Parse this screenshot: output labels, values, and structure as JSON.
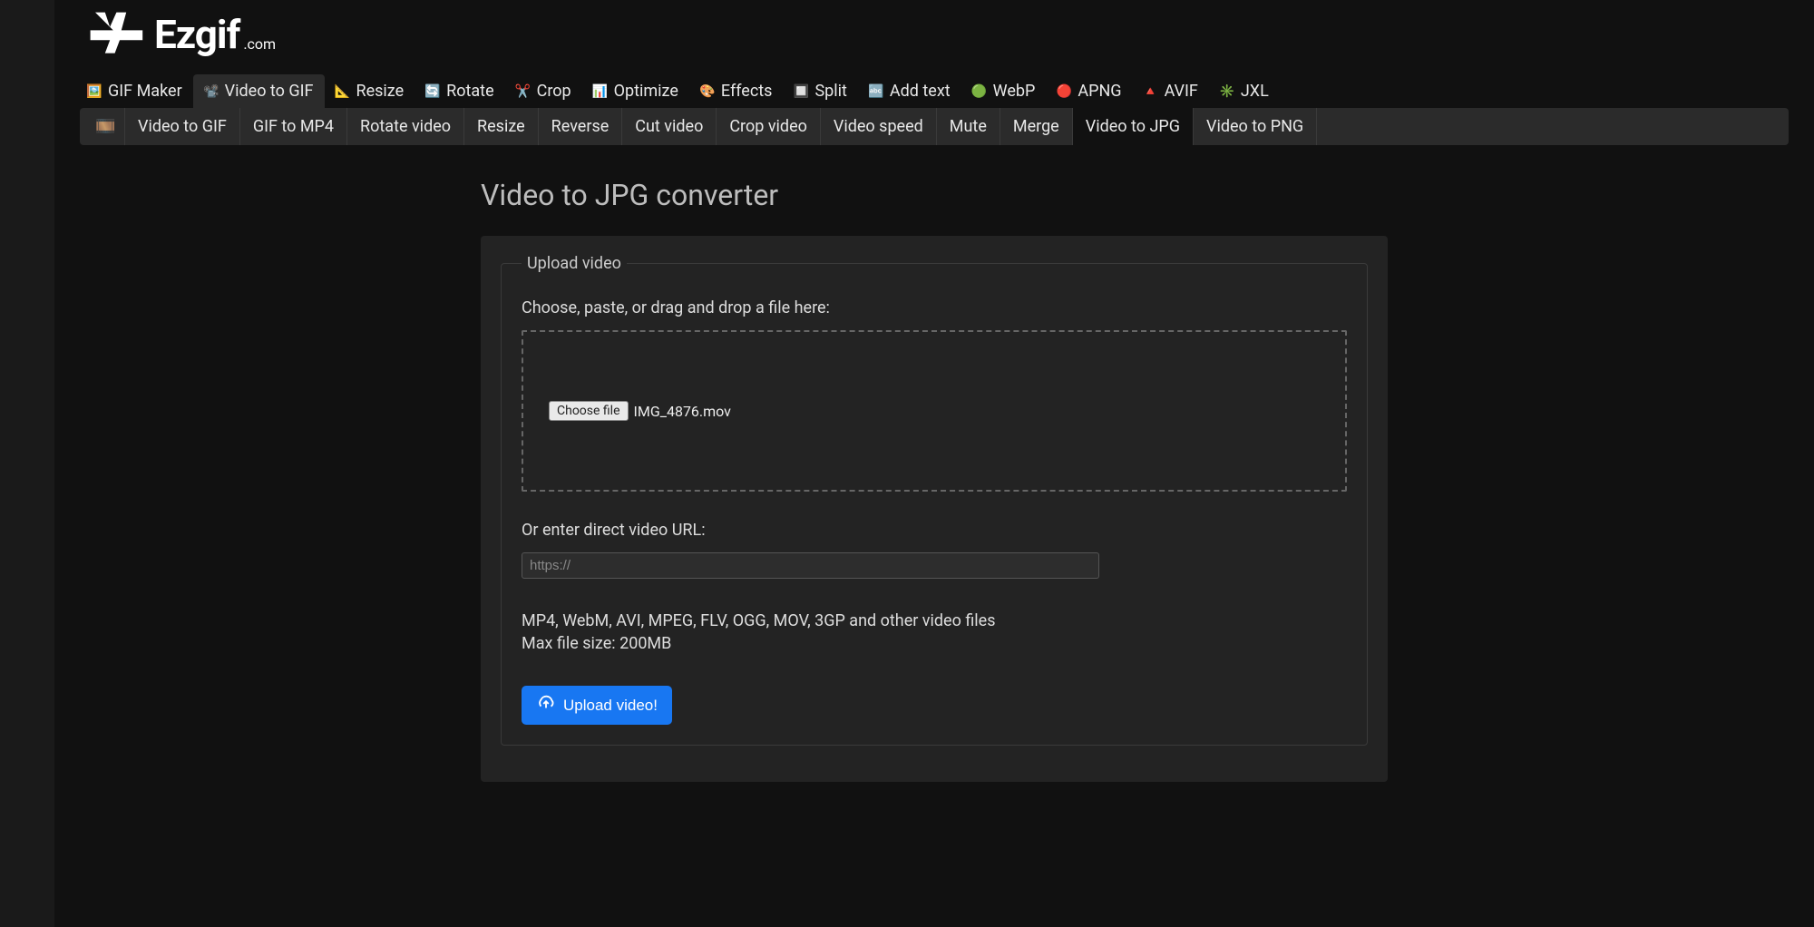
{
  "brand": {
    "name": "Ezgif",
    "tld": ".com"
  },
  "nav_primary": [
    {
      "label": "GIF Maker",
      "icon": "🖼️"
    },
    {
      "label": "Video to GIF",
      "icon": "📽️",
      "active": true
    },
    {
      "label": "Resize",
      "icon": "📐"
    },
    {
      "label": "Rotate",
      "icon": "🔄"
    },
    {
      "label": "Crop",
      "icon": "✂️"
    },
    {
      "label": "Optimize",
      "icon": "📊"
    },
    {
      "label": "Effects",
      "icon": "🎨"
    },
    {
      "label": "Split",
      "icon": "🔲"
    },
    {
      "label": "Add text",
      "icon": "🔤"
    },
    {
      "label": "WebP",
      "icon": "🟢"
    },
    {
      "label": "APNG",
      "icon": "🔴"
    },
    {
      "label": "AVIF",
      "icon": "🔺"
    },
    {
      "label": "JXL",
      "icon": "✳️"
    }
  ],
  "nav_secondary": [
    {
      "label": "Video to GIF"
    },
    {
      "label": "GIF to MP4"
    },
    {
      "label": "Rotate video"
    },
    {
      "label": "Resize"
    },
    {
      "label": "Reverse"
    },
    {
      "label": "Cut video"
    },
    {
      "label": "Crop video"
    },
    {
      "label": "Video speed"
    },
    {
      "label": "Mute"
    },
    {
      "label": "Merge"
    },
    {
      "label": "Video to JPG",
      "active": true
    },
    {
      "label": "Video to PNG"
    }
  ],
  "page": {
    "title": "Video to JPG converter"
  },
  "upload": {
    "legend": "Upload video",
    "choose_label": "Choose, paste, or drag and drop a file here:",
    "choose_file_btn": "Choose file",
    "selected_file": "IMG_4876.mov",
    "url_label": "Or enter direct video URL:",
    "url_placeholder": "https://",
    "formats_hint": "MP4, WebM, AVI, MPEG, FLV, OGG, MOV, 3GP and other video files",
    "max_size_hint": "Max file size: 200MB",
    "submit_label": "Upload video!"
  }
}
